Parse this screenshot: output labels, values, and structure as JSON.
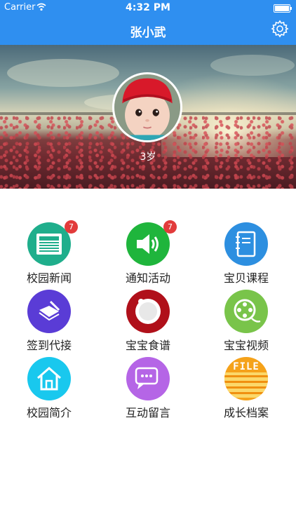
{
  "status_bar": {
    "carrier": "Carrier",
    "time": "4:32 PM"
  },
  "nav": {
    "title": "张小武",
    "settings_icon": "gear-icon"
  },
  "profile": {
    "age": "3岁",
    "avatar_icon": "baby-avatar"
  },
  "grid": {
    "items": [
      {
        "label": "校园新闻",
        "icon": "news-icon",
        "color": "#1fae8c",
        "badge": "7"
      },
      {
        "label": "通知活动",
        "icon": "speaker-icon",
        "color": "#1fb53c",
        "badge": "7"
      },
      {
        "label": "宝贝课程",
        "icon": "notebook-icon",
        "color": "#2d8fe0",
        "badge": ""
      },
      {
        "label": "签到代接",
        "icon": "signin-icon",
        "color": "#5a3cd6",
        "badge": ""
      },
      {
        "label": "宝宝食谱",
        "icon": "plate-icon",
        "color": "#b0101a",
        "badge": ""
      },
      {
        "label": "宝宝视频",
        "icon": "film-reel-icon",
        "color": "#79c44a",
        "badge": ""
      },
      {
        "label": "校园简介",
        "icon": "home-icon",
        "color": "#19c8ee",
        "badge": ""
      },
      {
        "label": "互动留言",
        "icon": "chat-icon",
        "color": "#b565e6",
        "badge": ""
      },
      {
        "label": "成长档案",
        "icon": "file-icon",
        "color": "#f5a21a",
        "badge": "",
        "icon_text": "FILE"
      }
    ]
  }
}
